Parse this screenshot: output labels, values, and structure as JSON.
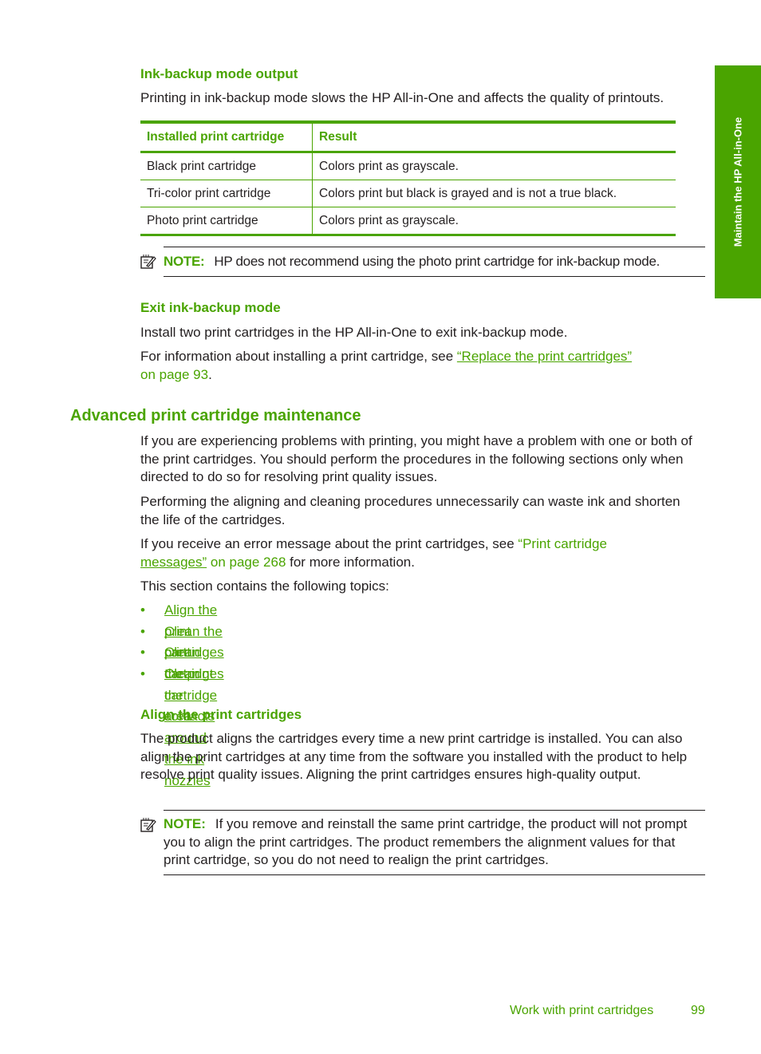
{
  "side_tab": {
    "label": "Maintain the HP All-in-One"
  },
  "section1": {
    "heading": "Ink-backup mode output",
    "intro": "Printing in ink-backup mode slows the HP All-in-One and affects the quality of printouts.",
    "table": {
      "headers": [
        "Installed print cartridge",
        "Result"
      ],
      "rows": [
        [
          "Black print cartridge",
          "Colors print as grayscale."
        ],
        [
          "Tri-color print cartridge",
          "Colors print but black is grayed and is not a true black."
        ],
        [
          "Photo print cartridge",
          "Colors print as grayscale."
        ]
      ]
    },
    "note": {
      "label": "NOTE:",
      "text": "HP does not recommend using the photo print cartridge for ink-backup mode."
    }
  },
  "section2": {
    "heading": "Exit ink-backup mode",
    "para1": "Install two print cartridges in the HP All-in-One to exit ink-backup mode.",
    "para2_prefix": "For information about installing a print cartridge, see ",
    "para2_link": "“Replace the print cartridges”",
    "para2_page": "on page 93",
    "para2_suffix": "."
  },
  "section3": {
    "heading": "Advanced print cartridge maintenance",
    "para1": "If you are experiencing problems with printing, you might have a problem with one or both of the print cartridges. You should perform the procedures in the following sections only when directed to do so for resolving print quality issues.",
    "para2": "Performing the aligning and cleaning procedures unnecessarily can waste ink and shorten the life of the cartridges.",
    "para3_prefix": "If you receive an error message about the print cartridges, see ",
    "para3_link_a": "“Print cartridge",
    "para3_link_b": "messages”",
    "para3_page": " on page 268",
    "para3_suffix": " for more information.",
    "para4": "This section contains the following topics:",
    "topics": [
      "Align the print cartridges",
      "Clean the print cartridges",
      "Clean the print cartridge contacts",
      "Clean the area around the ink nozzles"
    ],
    "bullet": "•"
  },
  "section4": {
    "heading": "Align the print cartridges",
    "para1": "The product aligns the cartridges every time a new print cartridge is installed. You can also align the print cartridges at any time from the software you installed with the product to help resolve print quality issues. Aligning the print cartridges ensures high-quality output.",
    "note": {
      "label": "NOTE:",
      "text": "If you remove and reinstall the same print cartridge, the product will not prompt you to align the print cartridges. The product remembers the alignment values for that print cartridge, so you do not need to realign the print cartridges."
    }
  },
  "footer": {
    "chapter": "Work with print cartridges",
    "page": "99"
  }
}
